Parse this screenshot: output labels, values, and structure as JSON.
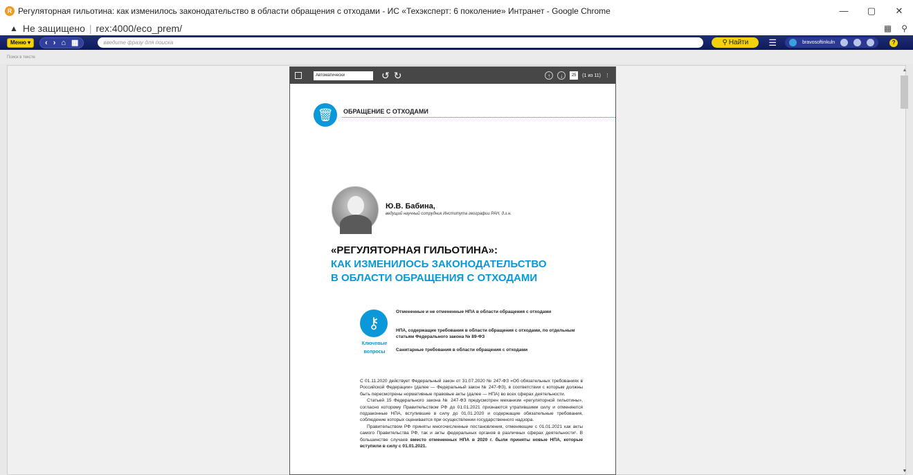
{
  "window": {
    "title": "Регуляторная гильотина: как изменилось законодательство в области обращения с отходами - ИС «Техэксперт: 6 поколение» Интранет - Google Chrome",
    "app_icon": "R"
  },
  "address_bar": {
    "security": "Не защищено",
    "url": "rex:4000/eco_prem/"
  },
  "toolbar": {
    "menu_label": "Меню ▾",
    "search_placeholder": "введите фразу для поиска",
    "find_label": "Найти",
    "username": "bravosoftinkuln"
  },
  "subbar": {
    "search_in_text": "Поиск в тексте"
  },
  "pdf_toolbar": {
    "scale": "Автоматически",
    "page_number": "25",
    "page_count": "(1 из 11)"
  },
  "page": {
    "section_title": "ОБРАЩЕНИЕ С ОТХОДАМИ",
    "author_name": "Ю.В. Бабина,",
    "author_desc": "ведущий научный сотрудник Института географии РАН, д.з.н.",
    "headline_1": "«РЕГУЛЯТОРНАЯ ГИЛЬОТИНА»:",
    "headline_2": "КАК ИЗМЕНИЛОСЬ ЗАКОНОДАТЕЛЬСТВО",
    "headline_3": "В ОБЛАСТИ ОБРАЩЕНИЯ С ОТХОДАМИ",
    "key_label_1": "Ключевые",
    "key_label_2": "вопросы",
    "key_questions": [
      "Отмененные и не отмененные НПА в области обращения с отходами",
      "НПА, содержащие требования в области обращения с отходами, по отдельным статьям Федерального закона № 89-ФЗ",
      "Санитарные требования в области обращения с отходами"
    ],
    "paragraph_1": "С 01.11.2020 действует Федеральный закон от 31.07.2020 № 247-ФЗ «Об обязательных требованиях в Российской Федерации» (далее — Федеральный закон № 247-ФЗ), в соответствии с которым должны быть пересмотрены нормативные правовые акты (далее — НПА) во всех сферах деятельности.",
    "paragraph_2": "Статьей 15 Федерального закона № 247-ФЗ предусмотрен механизм «регуляторной гильотины», согласно которому Правительством РФ до 01.01.2021 признаются утратившими силу и отменяются подзаконные НПА, вступившие в силу до 01.01.2020 и содержащие обязательные требования, соблюдение которых оценивается при осуществлении государственного надзора.",
    "paragraph_3a": "Правительством РФ приняты многочисленные постановления, отменяющие с 01.01.2021 как акты самого Правительства РФ, так и акты федеральных органов в различных сферах деятельности¹. В большинстве случаев ",
    "paragraph_3b": "вместо отмененных НПА в 2020 г. были приняты новые НПА, которые вступили в силу с 01.01.2021."
  }
}
